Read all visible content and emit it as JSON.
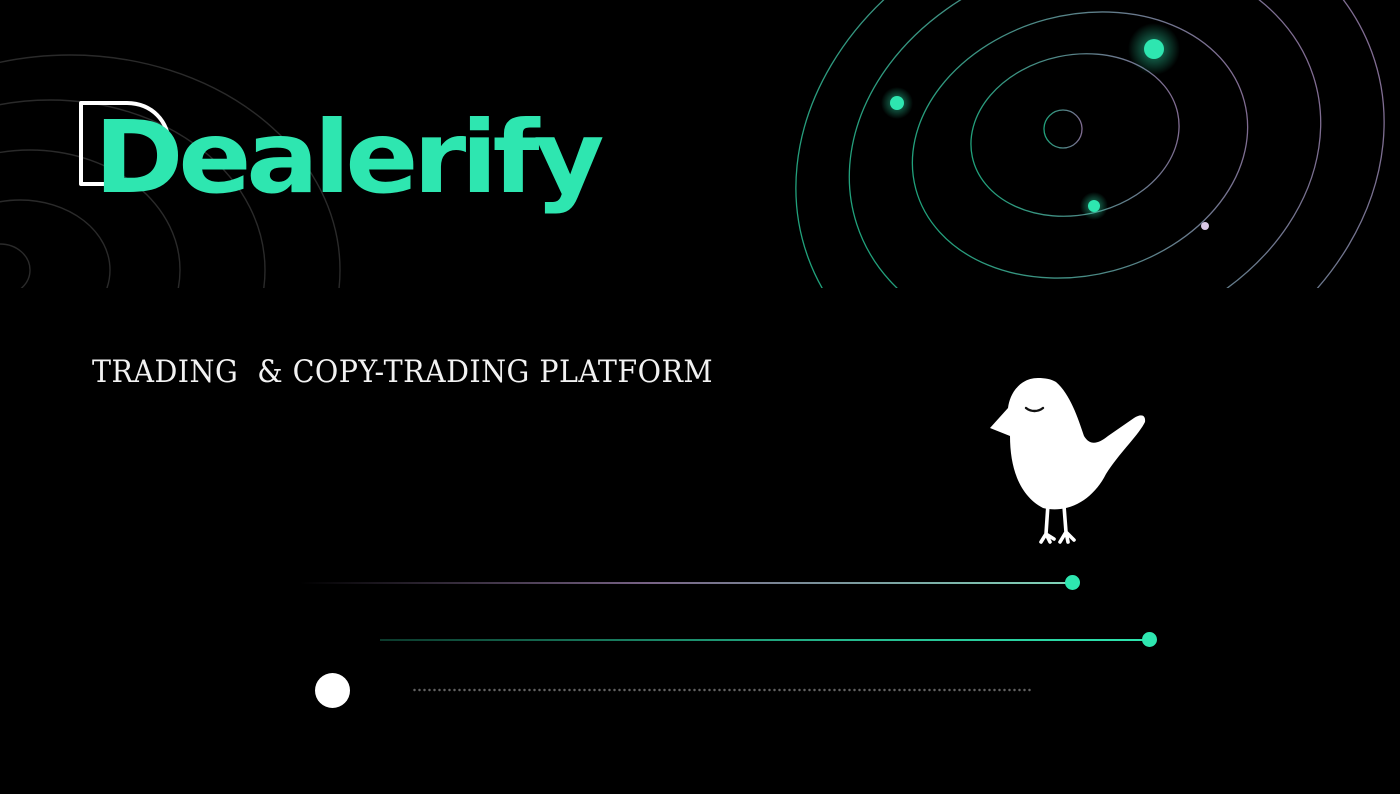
{
  "brand": {
    "name": "Dealerify",
    "color": "#2ee6b0",
    "outline_color": "#ffffff"
  },
  "tagline": "TRADING  & COPY-TRADING PLATFORM",
  "icons": {
    "mascot": "bird-icon",
    "orbit": "orbit-rings-icon"
  },
  "colors": {
    "background": "#000000",
    "accent": "#2ee6b0",
    "secondary": "#b79ad0",
    "text": "#f2f2f2"
  }
}
